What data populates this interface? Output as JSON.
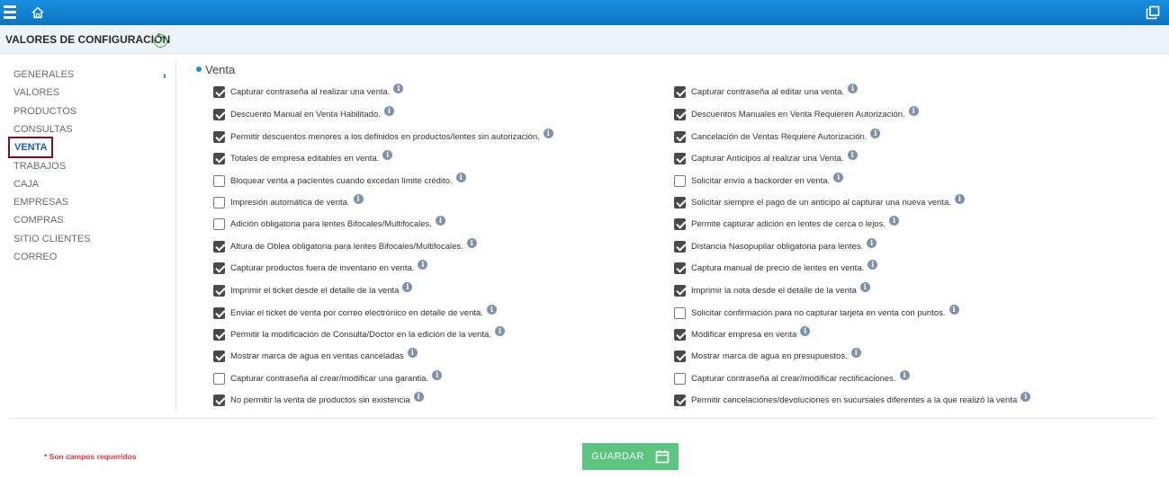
{
  "header": {
    "title": "VALORES DE CONFIGURACIÓN",
    "help_glyph": "?"
  },
  "icons": {
    "menu": "hamburger-icon",
    "home": "home-icon",
    "window": "restore-window-icon",
    "info": "info-icon",
    "save": "calendar-icon"
  },
  "sidebar": {
    "items": [
      {
        "label": "GENERALES",
        "top": 0
      },
      {
        "label": "VALORES"
      },
      {
        "label": "PRODUCTOS"
      },
      {
        "label": "CONSULTAS"
      },
      {
        "label": "VENTA",
        "active": true
      },
      {
        "label": "TRABAJOS"
      },
      {
        "label": "CAJA"
      },
      {
        "label": "EMPRESAS"
      },
      {
        "label": "COMPRAS"
      },
      {
        "label": "SITIO CLIENTES"
      },
      {
        "label": "CORREO"
      }
    ],
    "chevron": "›"
  },
  "section": {
    "title": "Venta"
  },
  "options_left": [
    {
      "label": "Capturar contraseña al realizar una venta.",
      "checked": true
    },
    {
      "label": "Descuento Manual en Venta Habilitado.",
      "checked": true
    },
    {
      "label": "Permitir descuentos menores a los definidos en productos/lentes sin autorización.",
      "checked": true
    },
    {
      "label": "Totales de empresa editables en venta.",
      "checked": true
    },
    {
      "label": "Bloquear venta a pacientes cuando excedan límite crédito.",
      "checked": false
    },
    {
      "label": "Impresión automática de venta.",
      "checked": false
    },
    {
      "label": "Adición obligatoria para lentes Bifocales/Multifocales.",
      "checked": false
    },
    {
      "label": "Altura de Oblea obligatoria para lentes Bifocales/Multifocales.",
      "checked": true
    },
    {
      "label": "Capturar productos fuera de inventario en venta.",
      "checked": true
    },
    {
      "label": "Imprimir el ticket desde el detalle de la venta",
      "checked": true
    },
    {
      "label": "Enviar el ticket de venta por correo electrónico en detalle de venta.",
      "checked": true
    },
    {
      "label": "Permitir la modificación de Consulta/Doctor en la edición de la venta.",
      "checked": true
    },
    {
      "label": "Mostrar marca de agua en ventas canceladas",
      "checked": true
    },
    {
      "label": "Capturar contraseña al crear/modificar una garantia.",
      "checked": false
    },
    {
      "label": "No permitir la venta de productos sin existencia",
      "checked": true
    }
  ],
  "options_right": [
    {
      "label": "Capturar contraseña al editar una venta.",
      "checked": true
    },
    {
      "label": "Descuentos Manuales en Venta Requieren Autorización.",
      "checked": true
    },
    {
      "label": "Cancelación de Ventas Requiere Autorización.",
      "checked": true
    },
    {
      "label": "Capturar Anticipos al realizar una Venta.",
      "checked": true
    },
    {
      "label": "Solicitar envío a backorder en venta.",
      "checked": false
    },
    {
      "label": "Solicitar siempre el pago de un anticipo al capturar una nueva venta.",
      "checked": true
    },
    {
      "label": "Permite capturar adición en lentes de cerca o lejos.",
      "checked": true
    },
    {
      "label": "Distancia Nasopupilar obligatoria para lentes.",
      "checked": true
    },
    {
      "label": "Captura manual de precio de lentes en venta.",
      "checked": true
    },
    {
      "label": "Imprimir la nota desde el detalle de la venta",
      "checked": true
    },
    {
      "label": "Solicitar confirmación para no capturar tarjeta en venta con puntos.",
      "checked": false
    },
    {
      "label": "Modificar empresa en venta",
      "checked": true
    },
    {
      "label": "Mostrar marca de agua en presupuestos.",
      "checked": true
    },
    {
      "label": "Capturar contraseña al crear/modificar rectificaciones.",
      "checked": false
    },
    {
      "label": "Permitir cancelaciones/devoluciones en sucursales diferentes a la que realizó la venta",
      "checked": true
    }
  ],
  "footer": {
    "required_note": "* Son campos requeridos",
    "save_label": "GUARDAR"
  },
  "colors": {
    "topbar": "#1a8ee0",
    "active_border": "#7a1020",
    "save_button": "#5cc47e",
    "required": "#e53935"
  }
}
